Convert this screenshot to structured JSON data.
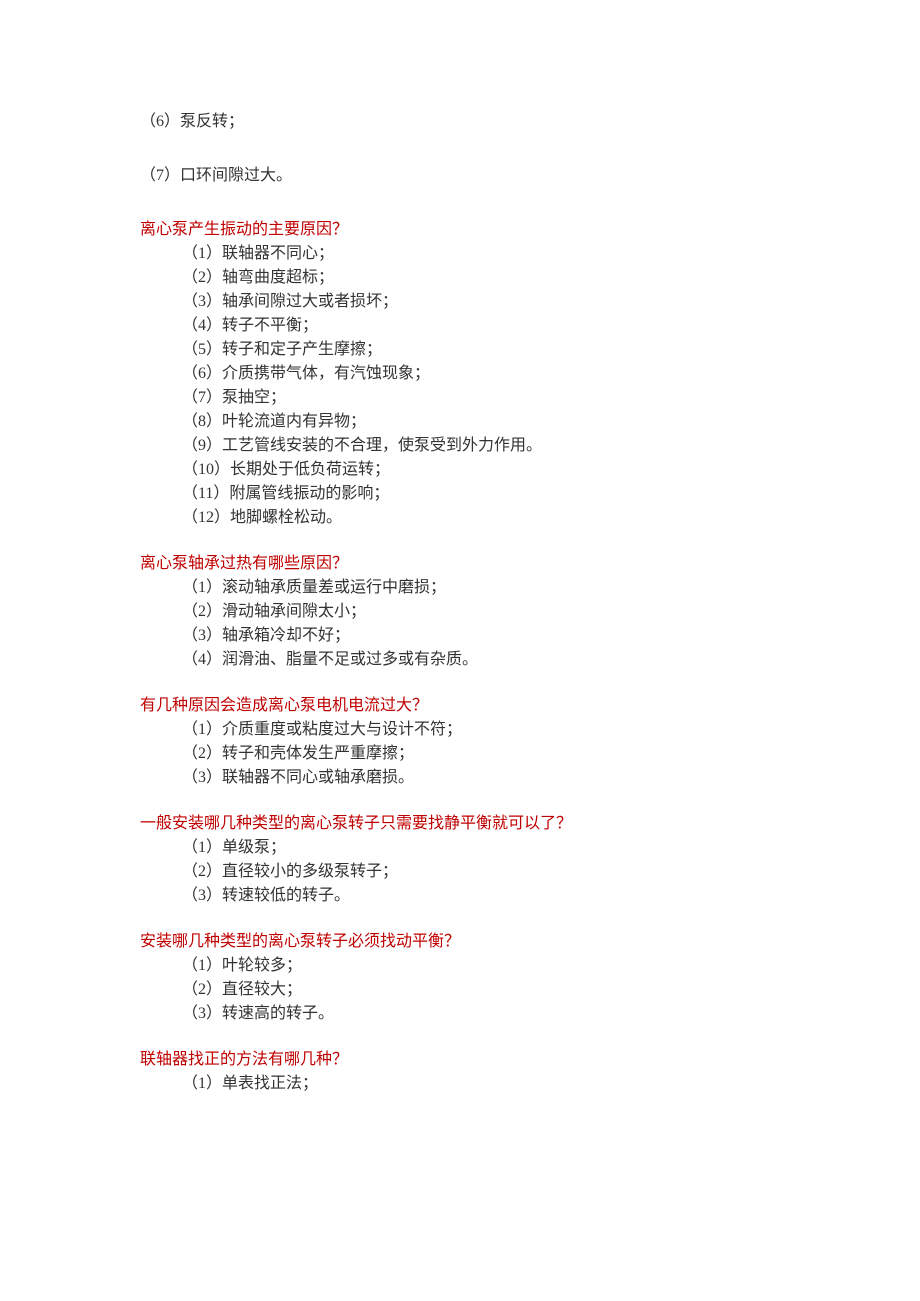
{
  "standalone": [
    "（6）泵反转；",
    "（7）口环间隙过大。"
  ],
  "sections": [
    {
      "heading": "离心泵产生振动的主要原因？",
      "items": [
        "（1）联轴器不同心；",
        "（2）轴弯曲度超标；",
        "（3）轴承间隙过大或者损坏；",
        "（4）转子不平衡；",
        "（5）转子和定子产生摩擦；",
        "（6）介质携带气体，有汽蚀现象；",
        "（7）泵抽空；",
        "（8）叶轮流道内有异物；",
        "（9）工艺管线安装的不合理，使泵受到外力作用。",
        "（10）长期处于低负荷运转；",
        "（11）附属管线振动的影响；",
        "（12）地脚螺栓松动。"
      ]
    },
    {
      "heading": "离心泵轴承过热有哪些原因？",
      "items": [
        "（1）滚动轴承质量差或运行中磨损；",
        "（2）滑动轴承间隙太小；",
        "（3）轴承箱冷却不好；",
        "（4）润滑油、脂量不足或过多或有杂质。"
      ]
    },
    {
      "heading": "有几种原因会造成离心泵电机电流过大？",
      "items": [
        "（1）介质重度或粘度过大与设计不符；",
        "（2）转子和壳体发生严重摩擦；",
        "（3）联轴器不同心或轴承磨损。"
      ]
    },
    {
      "heading": "一般安装哪几种类型的离心泵转子只需要找静平衡就可以了？",
      "items": [
        "（1）单级泵；",
        "（2）直径较小的多级泵转子；",
        "（3）转速较低的转子。"
      ]
    },
    {
      "heading": "安装哪几种类型的离心泵转子必须找动平衡？",
      "items": [
        "（1）叶轮较多；",
        "（2）直径较大；",
        "（3）转速高的转子。"
      ]
    },
    {
      "heading": "联轴器找正的方法有哪几种？",
      "items": [
        "（1）单表找正法；"
      ]
    }
  ]
}
